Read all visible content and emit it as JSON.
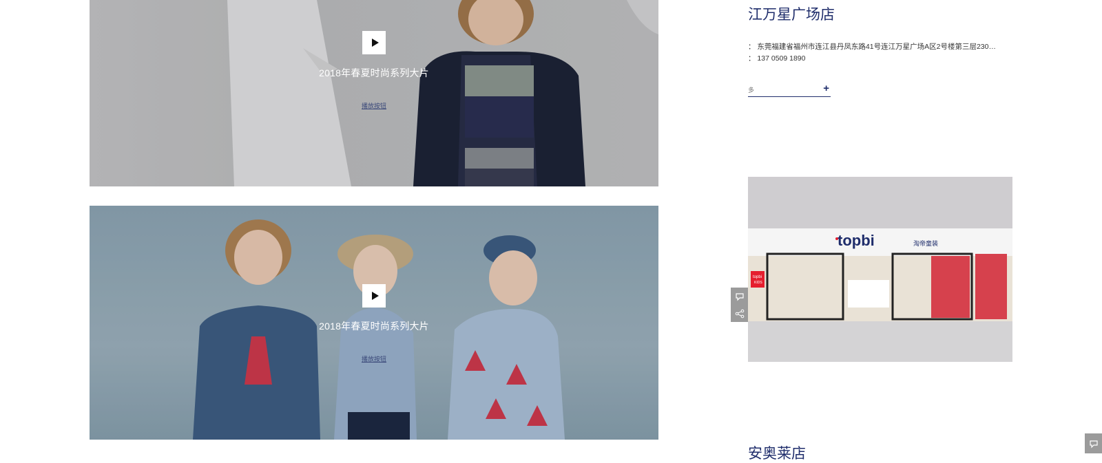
{
  "videos": [
    {
      "title": "2018年春夏时尚系列大片",
      "link_label": "播放按钮"
    },
    {
      "title": "2018年春夏时尚系列大片",
      "link_label": "播放按钮"
    }
  ],
  "stores": [
    {
      "name": "江万星广场店",
      "address": "： 东莞福建省福州市连江县丹凤东路41号连江万星广场A区2号楼第三层2301...",
      "phone": "： 137 0509 1890",
      "more_label": "多",
      "more_icon": "+"
    },
    {
      "name": "安奥莱店"
    }
  ],
  "store_photo": {
    "brand": "topbi",
    "sub_label": "淘帝童装",
    "side_badge_line1": "topbi",
    "side_badge_line2": "KIDS"
  },
  "colors": {
    "accent": "#1f2d6b",
    "side_tool_bg": "#9b9b9b",
    "brand_red": "#e51e2e"
  },
  "icons": [
    "play-icon",
    "chat-icon",
    "share-icon"
  ]
}
